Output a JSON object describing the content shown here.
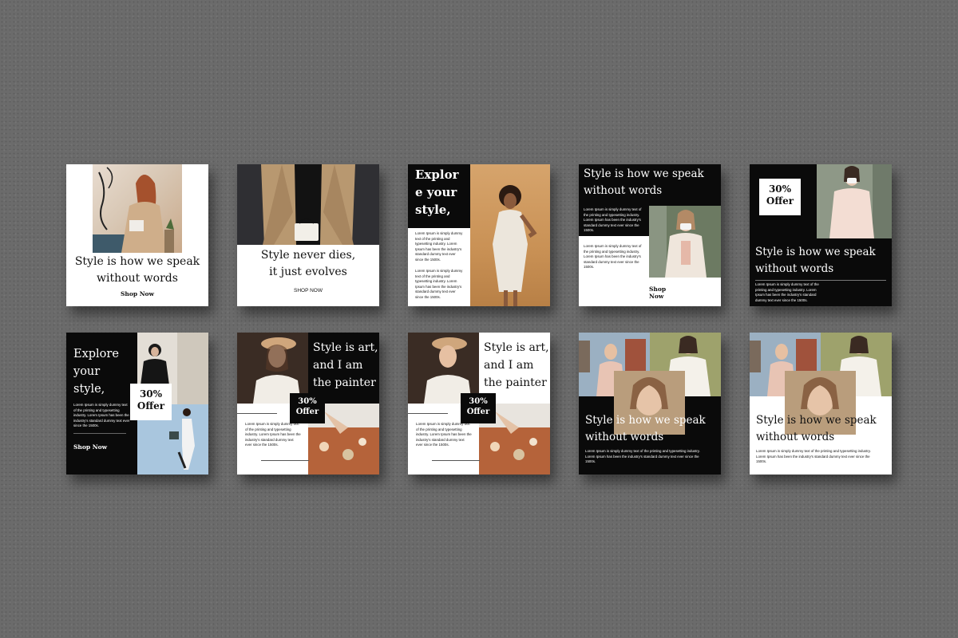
{
  "templates": {
    "t1": {
      "heading": "Style is how we speak without words",
      "cta": "Shop Now"
    },
    "t2": {
      "heading": "Style never dies, it just evolves",
      "cta": "SHOP NOW"
    },
    "t3": {
      "heading": "Explor e your style,",
      "body1": "Lorem Ipsum is simply dummy text of the printing and typesetting industry. Lorem Ipsum has been the industry's standard dummy text ever since the 1500s.",
      "body2": "Lorem Ipsum is simply dummy text of the printing and typesetting industry. Lorem Ipsum has been the industry's standard dummy text ever since the 1500s."
    },
    "t4": {
      "heading": "Style is how we speak without words",
      "body1": "Lorem Ipsum is simply dummy text of the printing and typesetting industry. Lorem Ipsum has been the industry's standard dummy text ever since the 1500s.",
      "body2": "Lorem Ipsum is simply dummy text of the printing and typesetting industry. Lorem Ipsum has been the industry's standard dummy text ever since the 1500s.",
      "cta": "Shop Now"
    },
    "t5": {
      "offer": "30% Offer",
      "heading": "Style is how we speak without words",
      "body": "Lorem Ipsum is simply dummy text of the printing and typesetting industry. Lorem Ipsum has been the industry's standard dummy text ever since the 1500s."
    },
    "t6": {
      "heading": "Explore your style,",
      "body": "Lorem Ipsum is simply dummy text of the printing and typesetting industry. Lorem Ipsum has been the industry's standard dummy text ever since the 1500s.",
      "offer": "30% Offer",
      "cta": "Shop Now"
    },
    "t7": {
      "heading": "Style is art, and I am the painter",
      "offer": "30% Offer",
      "body": "Lorem Ipsum is simply dummy text of the printing and typesetting industry. Lorem Ipsum has been the industry's standard dummy text ever since the 1500s."
    },
    "t8": {
      "heading": "Style is art, and I am the painter",
      "offer": "30% Offer",
      "body": "Lorem Ipsum is simply dummy text of the printing and typesetting industry. Lorem Ipsum has been the industry's standard dummy text ever since the 1500s."
    },
    "t9": {
      "heading": "Style is how we speak without words",
      "body": "Lorem Ipsum is simply dummy text of the printing and typesetting industry. Lorem Ipsum has been the industry's standard dummy text ever since the 1500s."
    },
    "t10": {
      "heading": "Style is how we speak without words",
      "body": "Lorem Ipsum is simply dummy text of the printing and typesetting industry. Lorem Ipsum has been the industry's standard dummy text ever since the 1500s."
    }
  },
  "colors": {
    "background": "#6b6b6b",
    "dark": "#0a0a0a",
    "light": "#ffffff"
  }
}
